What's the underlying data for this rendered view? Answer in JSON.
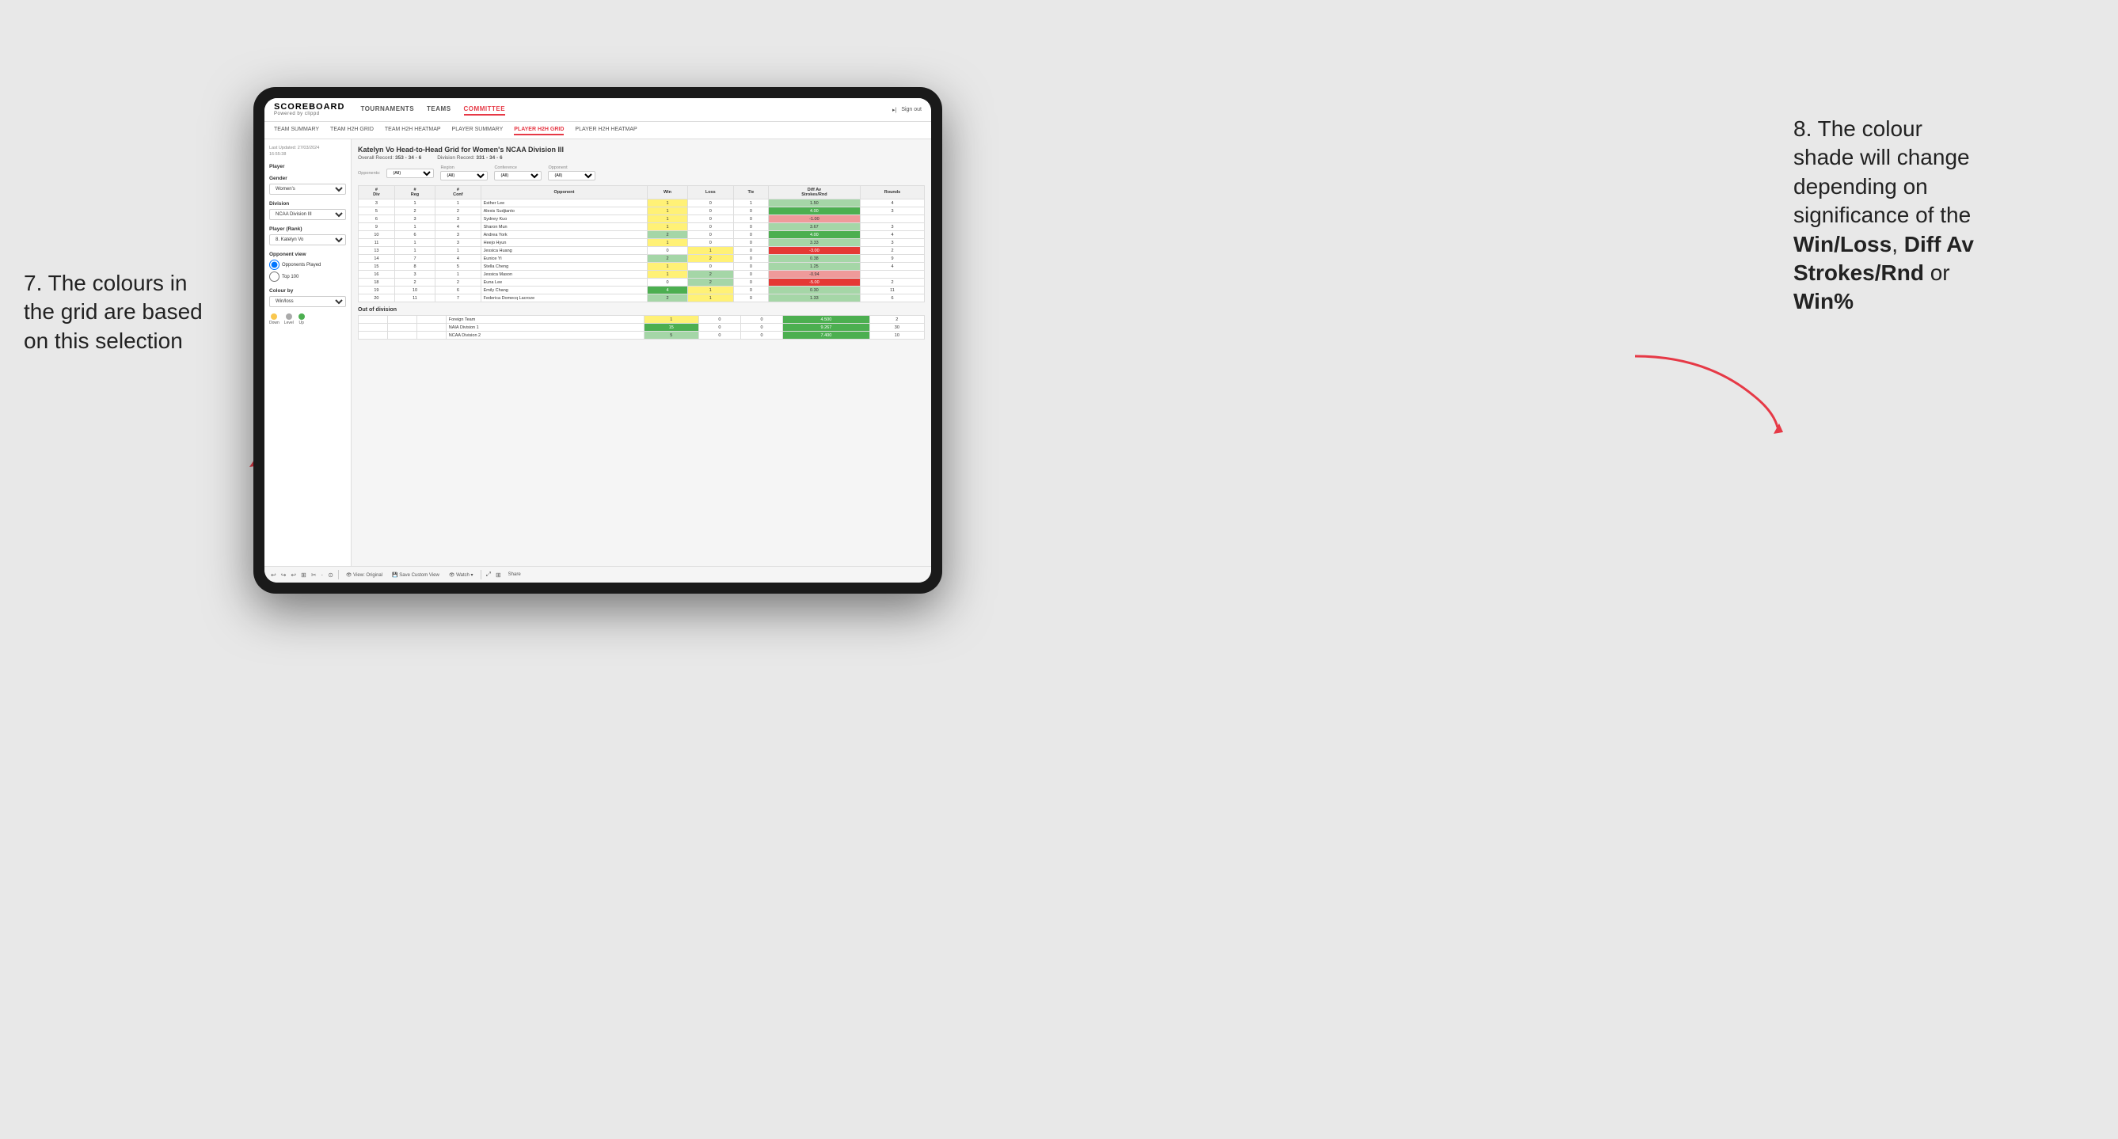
{
  "annotations": {
    "left_title": "7. The colours in",
    "left_line2": "the grid are based",
    "left_line3": "on this selection",
    "right_title": "8. The colour",
    "right_line2": "shade will change",
    "right_line3": "depending on",
    "right_line4": "significance of the",
    "right_bold1": "Win/Loss",
    "right_comma": ", ",
    "right_bold2": "Diff Av",
    "right_bold3": "Strokes/Rnd",
    "right_or": " or",
    "right_bold4": "Win%"
  },
  "nav": {
    "logo": "SCOREBOARD",
    "logo_sub": "Powered by clippd",
    "items": [
      "TOURNAMENTS",
      "TEAMS",
      "COMMITTEE"
    ],
    "active": "COMMITTEE",
    "sign_out": "Sign out"
  },
  "sub_nav": {
    "items": [
      "TEAM SUMMARY",
      "TEAM H2H GRID",
      "TEAM H2H HEATMAP",
      "PLAYER SUMMARY",
      "PLAYER H2H GRID",
      "PLAYER H2H HEATMAP"
    ],
    "active": "PLAYER H2H GRID"
  },
  "left_panel": {
    "last_updated_label": "Last Updated: 27/03/2024",
    "last_updated_time": "16:55:38",
    "player_label": "Player",
    "gender_label": "Gender",
    "gender_value": "Women's",
    "division_label": "Division",
    "division_value": "NCAA Division III",
    "player_rank_label": "Player (Rank)",
    "player_rank_value": "8. Katelyn Vo",
    "opponent_view_label": "Opponent view",
    "radio1": "Opponents Played",
    "radio2": "Top 100",
    "colour_by_label": "Colour by",
    "colour_by_value": "Win/loss",
    "legend": {
      "down_label": "Down",
      "level_label": "Level",
      "up_label": "Up"
    }
  },
  "grid": {
    "title": "Katelyn Vo Head-to-Head Grid for Women's NCAA Division III",
    "overall_record_label": "Overall Record:",
    "overall_record": "353 - 34 - 6",
    "division_record_label": "Division Record:",
    "division_record": "331 - 34 - 6",
    "filters": {
      "opponents_label": "Opponents:",
      "opponents_value": "(All)",
      "region_label": "Region",
      "region_value": "(All)",
      "conference_label": "Conference",
      "conference_value": "(All)",
      "opponent_label": "Opponent",
      "opponent_value": "(All)"
    },
    "col_headers": [
      "#\nDiv",
      "#\nReg",
      "#\nConf",
      "Opponent",
      "Win",
      "Loss",
      "Tie",
      "Diff Av\nStrokes/Rnd",
      "Rounds"
    ],
    "rows": [
      {
        "div": "3",
        "reg": "1",
        "conf": "1",
        "opponent": "Esther Lee",
        "win": "1",
        "loss": "0",
        "tie": "1",
        "diff": "1.50",
        "rounds": "4",
        "win_color": "yellow",
        "loss_color": "white",
        "tie_color": "white",
        "diff_color": "green_light"
      },
      {
        "div": "5",
        "reg": "2",
        "conf": "2",
        "opponent": "Alexis Sudjianto",
        "win": "1",
        "loss": "0",
        "tie": "0",
        "diff": "4.00",
        "rounds": "3",
        "win_color": "yellow",
        "loss_color": "white",
        "tie_color": "white",
        "diff_color": "green_dark"
      },
      {
        "div": "6",
        "reg": "3",
        "conf": "3",
        "opponent": "Sydney Kuo",
        "win": "1",
        "loss": "0",
        "tie": "0",
        "diff": "-1.00",
        "rounds": "",
        "win_color": "yellow",
        "loss_color": "white",
        "tie_color": "white",
        "diff_color": "red_light"
      },
      {
        "div": "9",
        "reg": "1",
        "conf": "4",
        "opponent": "Sharon Mun",
        "win": "1",
        "loss": "0",
        "tie": "0",
        "diff": "3.67",
        "rounds": "3",
        "win_color": "yellow",
        "loss_color": "white",
        "tie_color": "white",
        "diff_color": "green_light"
      },
      {
        "div": "10",
        "reg": "6",
        "conf": "3",
        "opponent": "Andrea York",
        "win": "2",
        "loss": "0",
        "tie": "0",
        "diff": "4.00",
        "rounds": "4",
        "win_color": "green_light",
        "loss_color": "white",
        "tie_color": "white",
        "diff_color": "green_dark"
      },
      {
        "div": "11",
        "reg": "1",
        "conf": "3",
        "opponent": "Heejo Hyun",
        "win": "1",
        "loss": "0",
        "tie": "0",
        "diff": "3.33",
        "rounds": "3",
        "win_color": "yellow",
        "loss_color": "white",
        "tie_color": "white",
        "diff_color": "green_light"
      },
      {
        "div": "13",
        "reg": "1",
        "conf": "1",
        "opponent": "Jessica Huang",
        "win": "0",
        "loss": "1",
        "tie": "0",
        "diff": "-3.00",
        "rounds": "2",
        "win_color": "white",
        "loss_color": "yellow",
        "tie_color": "white",
        "diff_color": "red_dark"
      },
      {
        "div": "14",
        "reg": "7",
        "conf": "4",
        "opponent": "Eunice Yi",
        "win": "2",
        "loss": "2",
        "tie": "0",
        "diff": "0.38",
        "rounds": "9",
        "win_color": "green_light",
        "loss_color": "yellow",
        "tie_color": "white",
        "diff_color": "green_light"
      },
      {
        "div": "15",
        "reg": "8",
        "conf": "5",
        "opponent": "Stella Cheng",
        "win": "1",
        "loss": "0",
        "tie": "0",
        "diff": "1.25",
        "rounds": "4",
        "win_color": "yellow",
        "loss_color": "white",
        "tie_color": "white",
        "diff_color": "green_light"
      },
      {
        "div": "16",
        "reg": "3",
        "conf": "1",
        "opponent": "Jessica Mason",
        "win": "1",
        "loss": "2",
        "tie": "0",
        "diff": "-0.94",
        "rounds": "",
        "win_color": "yellow",
        "loss_color": "green_light",
        "tie_color": "white",
        "diff_color": "red_light"
      },
      {
        "div": "18",
        "reg": "2",
        "conf": "2",
        "opponent": "Euna Lee",
        "win": "0",
        "loss": "2",
        "tie": "0",
        "diff": "-5.00",
        "rounds": "2",
        "win_color": "white",
        "loss_color": "green_light",
        "tie_color": "white",
        "diff_color": "red_dark"
      },
      {
        "div": "19",
        "reg": "10",
        "conf": "6",
        "opponent": "Emily Chang",
        "win": "4",
        "loss": "1",
        "tie": "0",
        "diff": "0.30",
        "rounds": "11",
        "win_color": "green_dark",
        "loss_color": "yellow",
        "tie_color": "white",
        "diff_color": "green_light"
      },
      {
        "div": "20",
        "reg": "11",
        "conf": "7",
        "opponent": "Federica Domecq Lacroze",
        "win": "2",
        "loss": "1",
        "tie": "0",
        "diff": "1.33",
        "rounds": "6",
        "win_color": "green_light",
        "loss_color": "yellow",
        "tie_color": "white",
        "diff_color": "green_light"
      }
    ],
    "out_of_division_title": "Out of division",
    "out_of_division_rows": [
      {
        "label": "Foreign Team",
        "win": "1",
        "loss": "0",
        "tie": "0",
        "diff": "4.500",
        "rounds": "2",
        "win_color": "yellow",
        "loss_color": "white",
        "tie_color": "white",
        "diff_color": "green_dark"
      },
      {
        "label": "NAIA Division 1",
        "win": "15",
        "loss": "0",
        "tie": "0",
        "diff": "9.267",
        "rounds": "30",
        "win_color": "green_dark",
        "loss_color": "white",
        "tie_color": "white",
        "diff_color": "green_dark"
      },
      {
        "label": "NCAA Division 2",
        "win": "5",
        "loss": "0",
        "tie": "0",
        "diff": "7.400",
        "rounds": "10",
        "win_color": "green_light",
        "loss_color": "white",
        "tie_color": "white",
        "diff_color": "green_dark"
      }
    ]
  },
  "toolbar": {
    "buttons": [
      "⟲",
      "⟳",
      "⟲",
      "⊞",
      "✂·",
      "·",
      "⊙",
      "|",
      "View: Original",
      "Save Custom View",
      "Watch ▾",
      "|",
      "Share"
    ]
  }
}
